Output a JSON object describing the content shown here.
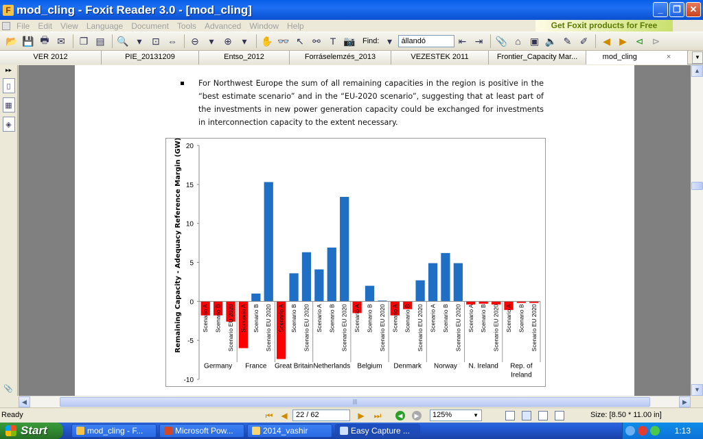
{
  "window": {
    "title": "mod_cling - Foxit Reader 3.0 - [mod_cling]",
    "minimize": "_",
    "maximize": "❐",
    "close": "✕"
  },
  "menu": {
    "items": [
      "File",
      "Edit",
      "View",
      "Language",
      "Document",
      "Tools",
      "Advanced",
      "Window",
      "Help"
    ],
    "promo": "Get Foxit products for Free"
  },
  "toolbar": {
    "find_label": "Find:",
    "find_value": "állandó"
  },
  "tabs": [
    {
      "label": "VER 2012"
    },
    {
      "label": "PIE_20131209"
    },
    {
      "label": "Entso_2012"
    },
    {
      "label": "Forráselemzés_2013"
    },
    {
      "label": "VEZESTEK 2011"
    },
    {
      "label": "Frontier_Capacity Mar..."
    },
    {
      "label": "mod_cling",
      "close": "×"
    }
  ],
  "document": {
    "paragraph": "For Northwest Europe the sum of all remaining capacities in the region is positive in the “best estimate scenario” and in the “EU-2020 scenario”, suggesting that at least part of the investments in new power generation capacity could be exchanged for investments in interconnection capacity to the extent necessary."
  },
  "chart_data": {
    "type": "bar",
    "ylabel": "Remaining Capacity - Adequacy Reference Margin (GW)",
    "ylim": [
      -10,
      20
    ],
    "yticks": [
      20,
      15,
      10,
      5,
      0,
      -5,
      -10
    ],
    "grid": false,
    "groups": [
      {
        "country": "Germany",
        "bars": [
          {
            "label": "Scenario A",
            "value": -1.8,
            "color": "#ff0000"
          },
          {
            "label": "Scenario B",
            "value": -1.8,
            "color": "#ff0000"
          },
          {
            "label": "Scenario EU 2020",
            "value": -2.6,
            "color": "#ff0000"
          }
        ]
      },
      {
        "country": "France",
        "bars": [
          {
            "label": "Scenario A",
            "value": -6.0,
            "color": "#ff0000"
          },
          {
            "label": "Scenario B",
            "value": 1.0,
            "color": "#1f6fc5"
          },
          {
            "label": "Scenario EU 2020",
            "value": 15.3,
            "color": "#1f6fc5"
          }
        ]
      },
      {
        "country": "Great Britain",
        "bars": [
          {
            "label": "Scenario A",
            "value": -7.4,
            "color": "#ff0000"
          },
          {
            "label": "Scenario B",
            "value": 3.6,
            "color": "#1f6fc5"
          },
          {
            "label": "Scenario EU 2020",
            "value": 6.3,
            "color": "#1f6fc5"
          }
        ]
      },
      {
        "country": "Netherlands",
        "bars": [
          {
            "label": "Scenario A",
            "value": 4.1,
            "color": "#1f6fc5"
          },
          {
            "label": "Scenario B",
            "value": 6.9,
            "color": "#1f6fc5"
          },
          {
            "label": "Scenario EU 2020",
            "value": 13.4,
            "color": "#1f6fc5"
          }
        ]
      },
      {
        "country": "Belgium",
        "bars": [
          {
            "label": "Scenario A",
            "value": -1.5,
            "color": "#ff0000"
          },
          {
            "label": "Scenario B",
            "value": 2.0,
            "color": "#1f6fc5"
          },
          {
            "label": "Scenario EU 2020",
            "value": 0.1,
            "color": "#1f6fc5"
          }
        ]
      },
      {
        "country": "Denmark",
        "bars": [
          {
            "label": "Scenario A",
            "value": -1.8,
            "color": "#ff0000"
          },
          {
            "label": "Scenario B",
            "value": -1.0,
            "color": "#ff0000"
          },
          {
            "label": "Scenario EU 2020",
            "value": 2.7,
            "color": "#1f6fc5"
          }
        ]
      },
      {
        "country": "Norway",
        "bars": [
          {
            "label": "Scenario A",
            "value": 4.9,
            "color": "#1f6fc5"
          },
          {
            "label": "Scenario B",
            "value": 6.2,
            "color": "#1f6fc5"
          },
          {
            "label": "Scenario EU 2020",
            "value": 4.9,
            "color": "#1f6fc5"
          }
        ]
      },
      {
        "country": "N. Ireland",
        "bars": [
          {
            "label": "Scenario A",
            "value": -0.4,
            "color": "#ff0000"
          },
          {
            "label": "Scenario B",
            "value": -0.3,
            "color": "#ff0000"
          },
          {
            "label": "Scenario EU 2020",
            "value": -0.4,
            "color": "#ff0000"
          }
        ]
      },
      {
        "country": "Rep. of Ireland",
        "bars": [
          {
            "label": "Scenario A",
            "value": -1.1,
            "color": "#ff0000"
          },
          {
            "label": "Scenario B",
            "value": -0.2,
            "color": "#ff0000"
          },
          {
            "label": "Scenario EU 2020",
            "value": -0.2,
            "color": "#ff0000"
          }
        ]
      }
    ]
  },
  "status": {
    "ready": "Ready",
    "page": "22 / 62",
    "zoom": "125%",
    "size": "Size: [8.50 * 11.00 in]"
  },
  "taskbar": {
    "start": "Start",
    "tasks": [
      "mod_cling - F...",
      "Microsoft Pow...",
      "2014_vashir",
      "Easy Capture ..."
    ],
    "clock": "1:13"
  }
}
